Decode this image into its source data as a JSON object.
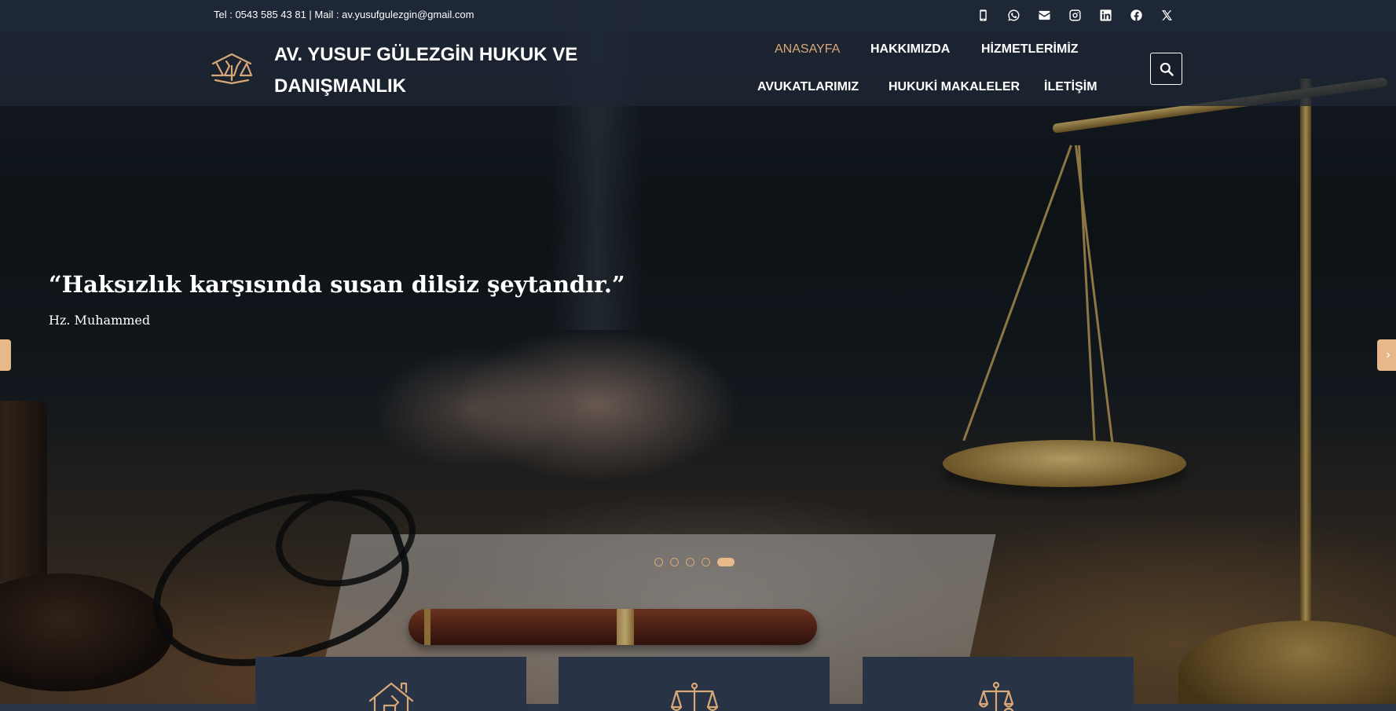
{
  "topbar": {
    "contact": "Tel : 0543 585 43 81 | Mail : av.yusufgulezgin@gmail.com",
    "socials": [
      "mobile-icon",
      "whatsapp-icon",
      "mail-icon",
      "instagram-icon",
      "linkedin-icon",
      "facebook-icon",
      "x-icon"
    ]
  },
  "header": {
    "brand_line1": "AV. YUSUF GÜLEZGİN HUKUK VE",
    "brand_line2": "DANIŞMANLIK",
    "nav": [
      {
        "label": "ANASAYFA",
        "active": true
      },
      {
        "label": "HAKKIMIZDA",
        "active": false
      },
      {
        "label": "HİZMETLERİMİZ",
        "active": false
      },
      {
        "label": "AVUKATLARIMIZ",
        "active": false
      },
      {
        "label": "HUKUKİ MAKALELER",
        "active": false
      },
      {
        "label": "İLETİŞİM",
        "active": false
      }
    ],
    "search_icon": "search-icon"
  },
  "slider": {
    "quote": "“Haksızlık karşısında susan dilsiz şeytandır.”",
    "author": "Hz. Muhammed",
    "next_arrow": "›",
    "slide_count": 5,
    "active_slide": 5
  },
  "cards": [
    {
      "icon": "house-icon"
    },
    {
      "icon": "scales-icon"
    },
    {
      "icon": "scales-person-icon"
    }
  ],
  "colors": {
    "accent": "#d9a877",
    "topbar": "#1f2837",
    "card": "#293346"
  }
}
